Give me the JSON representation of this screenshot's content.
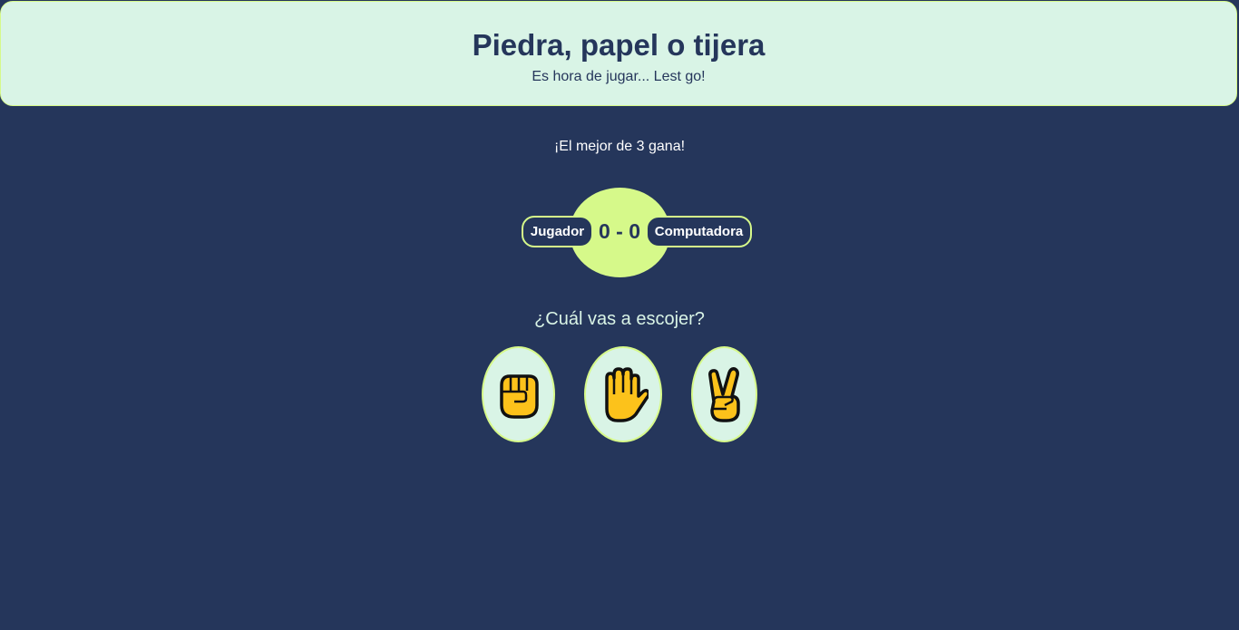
{
  "header": {
    "title": "Piedra, papel o tijera",
    "subtitle": "Es hora de jugar... Lest go!"
  },
  "rules": {
    "best_of": "¡El mejor de 3 gana!"
  },
  "scoreboard": {
    "player_label": "Jugador",
    "computer_label": "Computadora",
    "score_text": "0 - 0"
  },
  "prompt": {
    "question": "¿Cuál vas a escojer?"
  },
  "choices": [
    {
      "id": "rock",
      "icon": "raised-fist-icon"
    },
    {
      "id": "paper",
      "icon": "raised-hand-icon"
    },
    {
      "id": "scissors",
      "icon": "victory-hand-icon"
    }
  ],
  "colors": {
    "background": "#25365b",
    "accent": "#d6f98a",
    "panel": "#d9f4e6",
    "emoji_skin": "#fcc21b"
  }
}
